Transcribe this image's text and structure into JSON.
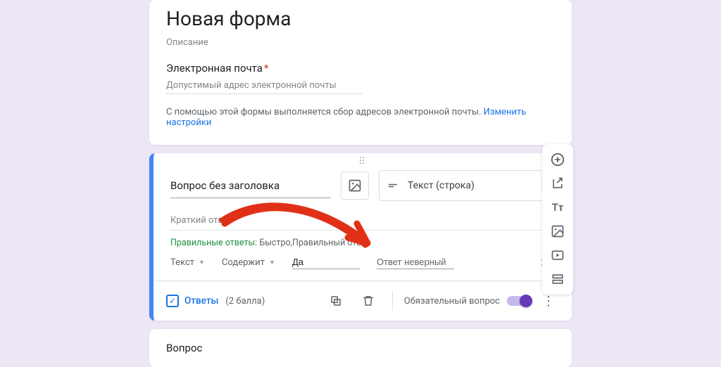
{
  "header": {
    "form_title": "Новая форма",
    "description": "Описание",
    "email_label": "Электронная почта",
    "email_placeholder": "Допустимый адрес электронной почты",
    "email_hint_text": "С помощью этой формы выполняется сбор адресов электронной почты. ",
    "email_hint_link": "Изменить настройки"
  },
  "question": {
    "title": "Вопрос без заголовка",
    "type_label": "Текст (строка)",
    "short_answer_placeholder": "Краткий ответ",
    "correct_label": "Правильные ответы: ",
    "correct_values": "Быстро,Правильный ответ",
    "validation": {
      "kind": "Текст",
      "op": "Содержит",
      "value": "Да",
      "error_text": "Ответ неверный"
    },
    "footer": {
      "answers": "Ответы",
      "points": "(2 балла)",
      "required": "Обязательный вопрос"
    }
  },
  "next_question": {
    "title": "Вопрос"
  },
  "toolbar": {
    "add": "add-question-icon",
    "import": "import-question-icon",
    "title": "add-text-icon",
    "image": "add-image-icon",
    "video": "add-video-icon",
    "section": "add-section-icon"
  }
}
